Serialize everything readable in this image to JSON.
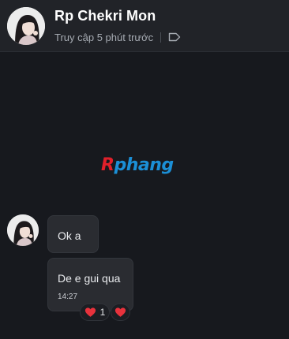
{
  "header": {
    "contact_name": "Rp Chekri Mon",
    "status": "Truy cập 5 phút trước",
    "tag_icon": "tag-icon"
  },
  "watermark": {
    "r": "R",
    "rest": "phang"
  },
  "messages": [
    {
      "text": "Ok a"
    },
    {
      "text": "De e gui qua",
      "time": "14:27"
    }
  ],
  "reactions": [
    {
      "icon": "heart-icon",
      "count": "1"
    },
    {
      "icon": "heart-icon"
    }
  ],
  "colors": {
    "background": "#17191e",
    "header": "#212328",
    "bubble": "#2a2c31",
    "heart": "#e8323c",
    "watermark_red": "#e0202a",
    "watermark_blue": "#1b8fd6"
  }
}
